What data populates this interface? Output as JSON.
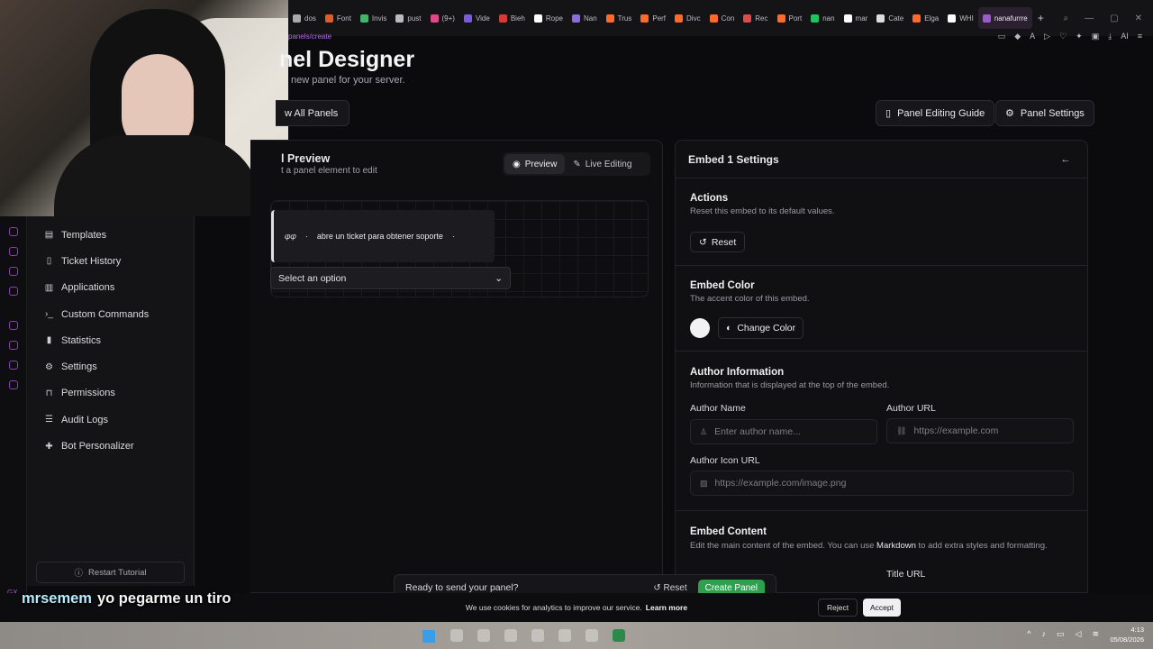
{
  "browser": {
    "tabs": [
      "dos",
      "Font",
      "Invis",
      "pust",
      "(9+)",
      "Vide",
      "Bieh",
      "Rope",
      "Nan",
      "Trus",
      "Perf",
      "Divc",
      "Con",
      "Rec",
      "Port",
      "nan",
      "mar",
      "Cate",
      "Elga",
      "WHI",
      "nanafurrre"
    ],
    "url": "panels/create"
  },
  "sidebar": {
    "items": [
      {
        "label": "Templates",
        "icon": "file-icon"
      },
      {
        "label": "Ticket History",
        "icon": "book-icon"
      },
      {
        "label": "Applications",
        "icon": "clipboard-icon"
      },
      {
        "label": "Custom Commands",
        "icon": "terminal-icon"
      },
      {
        "label": "Statistics",
        "icon": "bar-chart-icon"
      },
      {
        "label": "Settings",
        "icon": "gear-icon"
      },
      {
        "label": "Permissions",
        "icon": "lock-icon"
      },
      {
        "label": "Audit Logs",
        "icon": "list-icon"
      },
      {
        "label": "Bot Personalizer",
        "icon": "puzzle-icon"
      }
    ],
    "restart_tutorial": "Restart Tutorial"
  },
  "header": {
    "title": "nel Designer",
    "subtitle": "new panel for your server.",
    "view_all": "w All Panels",
    "guide": "Panel Editing Guide",
    "panel_settings": "Panel Settings"
  },
  "preview": {
    "title": "l Preview",
    "subtitle": "t a panel element to edit",
    "tab_preview": "Preview",
    "tab_live": "Live Editing",
    "embed_text": "abre un ticket para obtener soporte",
    "embed_prefix": "𝜑𝜑",
    "select_placeholder": "Select an option"
  },
  "settings": {
    "title": "Embed 1 Settings",
    "actions": {
      "title": "Actions",
      "desc": "Reset this embed to its default values.",
      "reset": "Reset"
    },
    "color": {
      "title": "Embed Color",
      "desc": "The accent color of this embed.",
      "change": "Change Color",
      "value": "#f2f2f4"
    },
    "author": {
      "title": "Author Information",
      "desc": "Information that is displayed at the top of the embed.",
      "name_label": "Author Name",
      "name_placeholder": "Enter author name...",
      "url_label": "Author URL",
      "url_placeholder": "https://example.com",
      "icon_label": "Author Icon URL",
      "icon_placeholder": "https://example.com/image.png"
    },
    "content": {
      "title": "Embed Content",
      "desc_a": "Edit the main content of the embed. You can use ",
      "desc_md": "Markdown",
      "desc_b": " to add extra styles and formatting.",
      "title_url_label": "Title URL"
    }
  },
  "savebar": {
    "text": "Ready to send your panel?",
    "reset": "Reset",
    "create": "Create Panel"
  },
  "cookie": {
    "text": "We use cookies for analytics to improve our service.",
    "learn": "Learn more",
    "reject": "Reject",
    "accept": "Accept"
  },
  "caption": {
    "user": "mrsemem",
    "text": "yo pegarme un tiro"
  },
  "taskbar": {
    "time": "4:13",
    "date": "05/08/2026"
  }
}
